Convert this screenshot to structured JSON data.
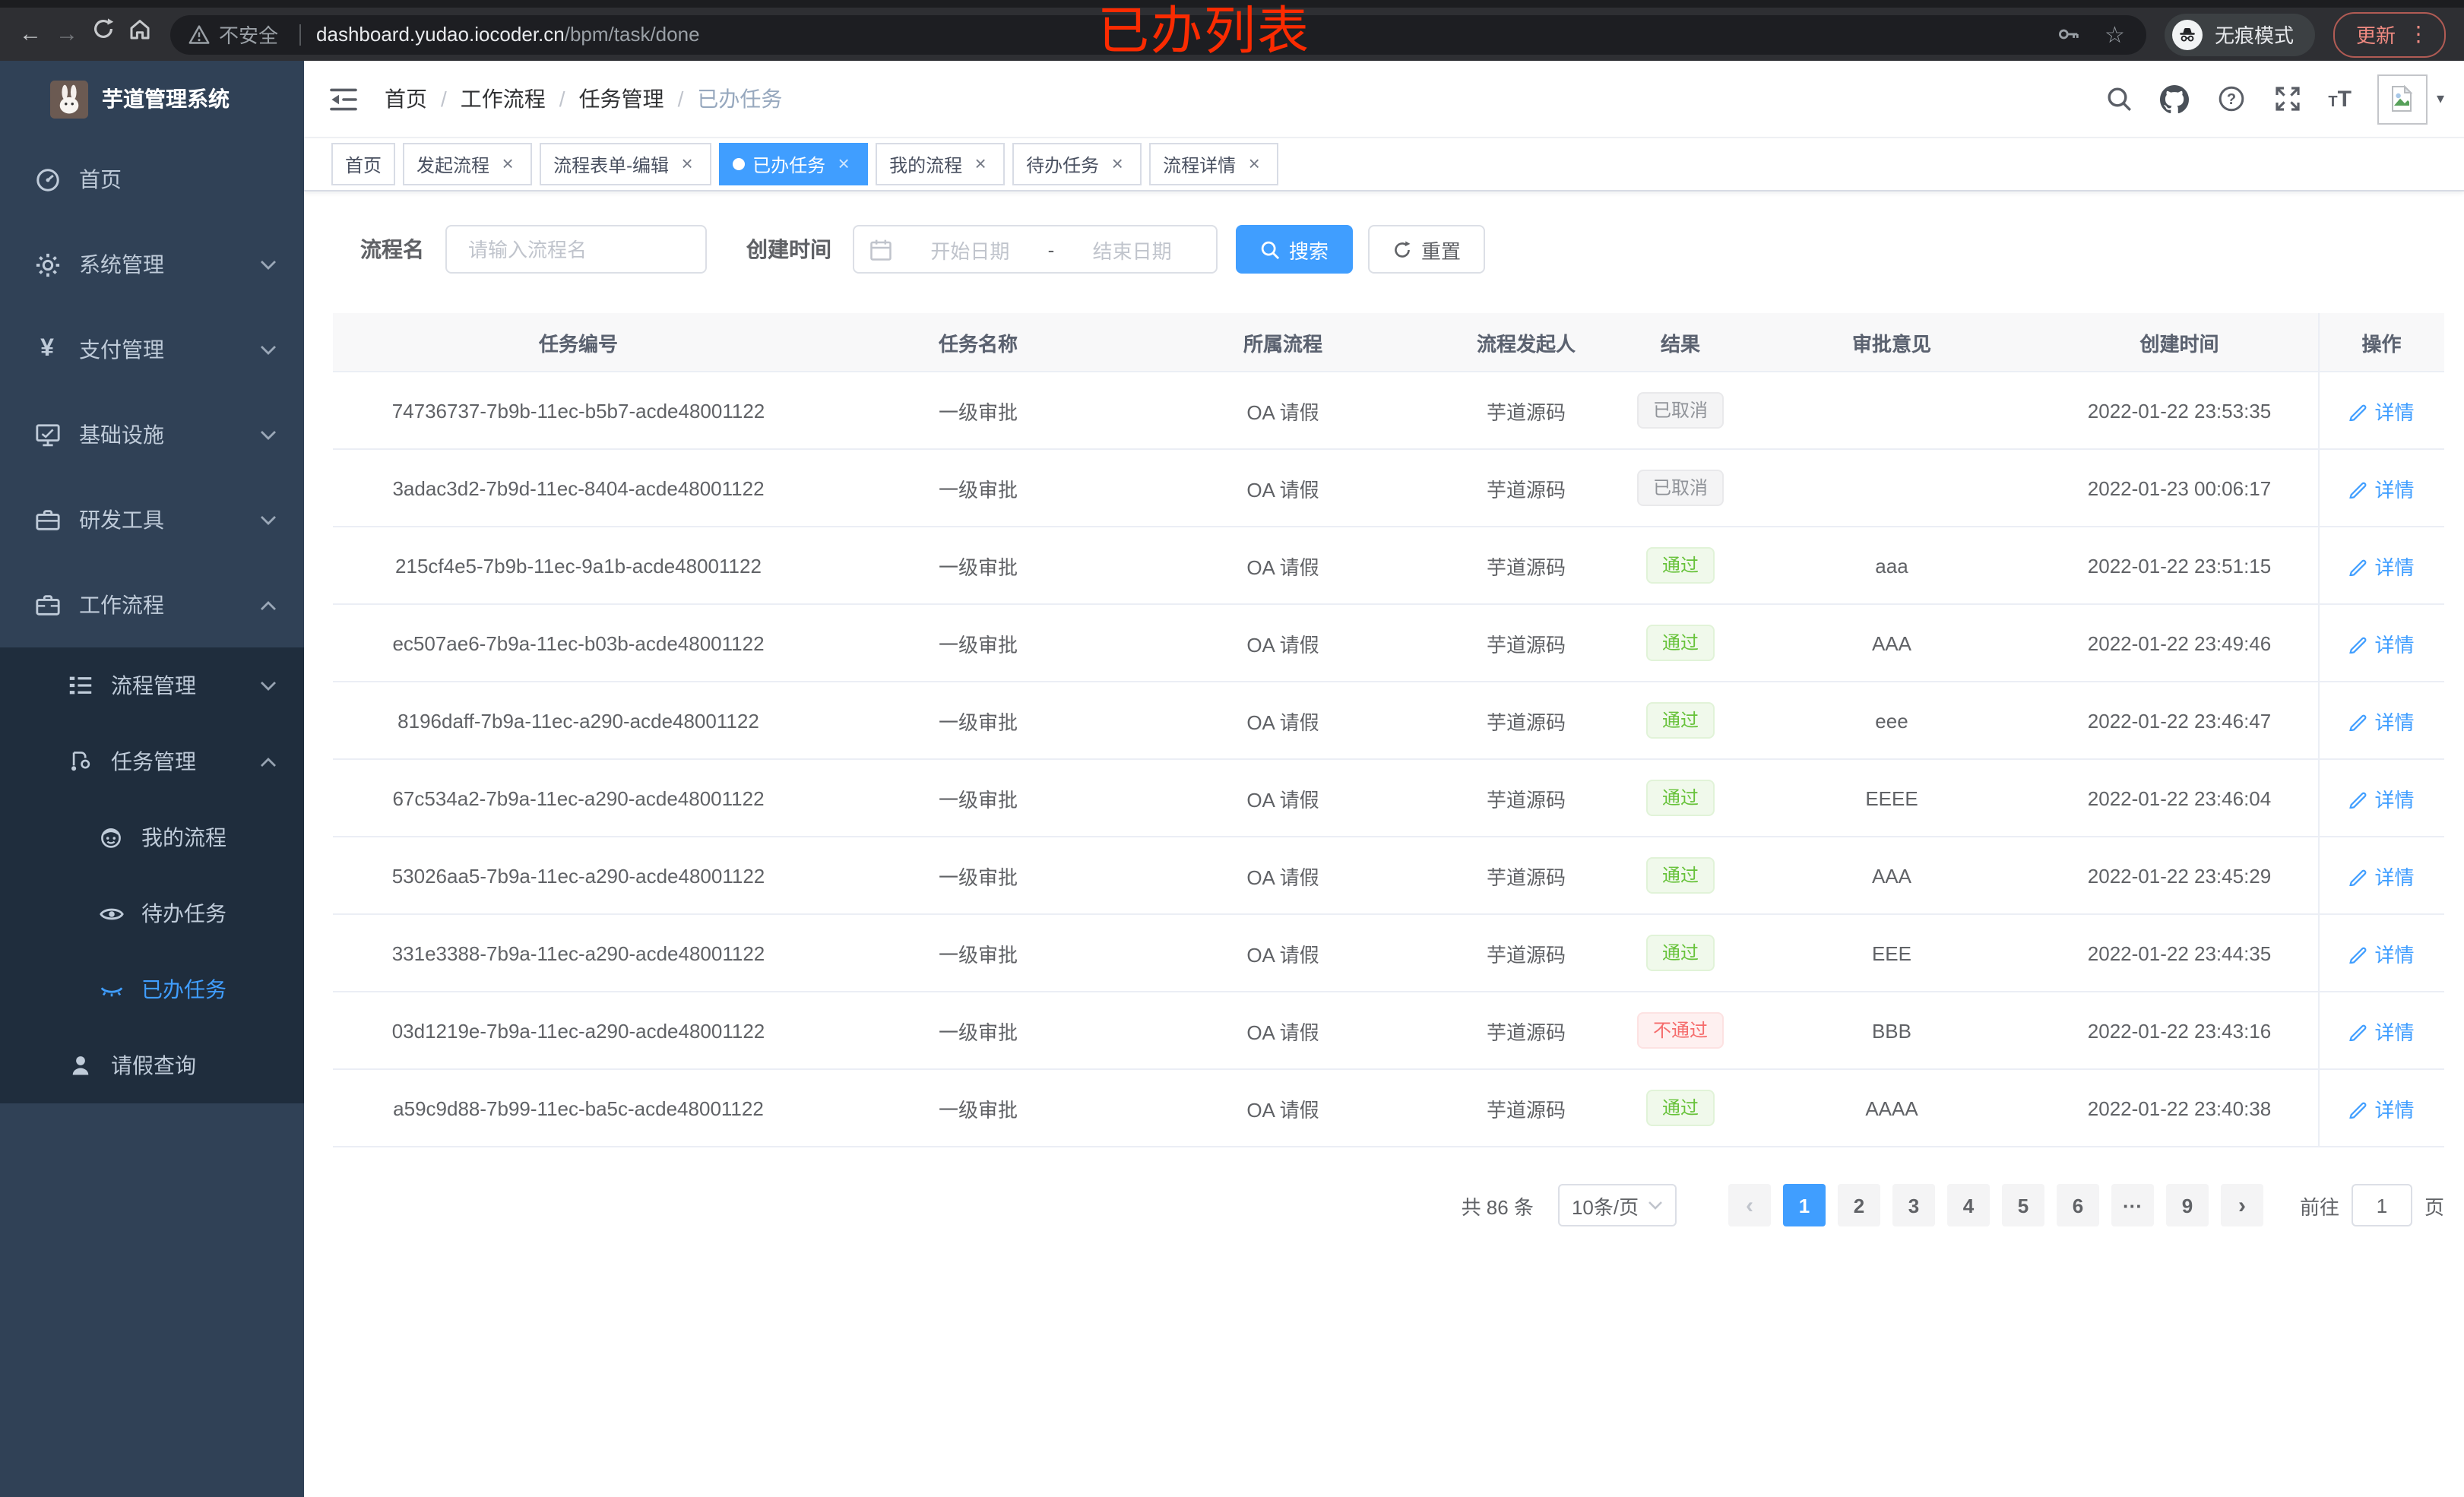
{
  "browser": {
    "security_label": "不安全",
    "url_domain": "dashboard.yudao.iocoder.cn",
    "url_path": "/bpm/task/done",
    "incognito_label": "无痕模式",
    "update_label": "更新"
  },
  "annotation": {
    "text": "已办列表",
    "color": "#fb2b01"
  },
  "sidebar": {
    "app_title": "芋道管理系统",
    "menu": [
      {
        "label": "首页"
      },
      {
        "label": "系统管理"
      },
      {
        "label": "支付管理"
      },
      {
        "label": "基础设施"
      },
      {
        "label": "研发工具"
      },
      {
        "label": "工作流程"
      }
    ],
    "submenu": [
      {
        "label": "流程管理"
      },
      {
        "label": "任务管理"
      },
      {
        "label": "我的流程"
      },
      {
        "label": "待办任务"
      },
      {
        "label": "已办任务"
      },
      {
        "label": "请假查询"
      }
    ]
  },
  "navbar": {
    "breadcrumb": [
      "首页",
      "工作流程",
      "任务管理",
      "已办任务"
    ]
  },
  "tabs": [
    {
      "label": "首页"
    },
    {
      "label": "发起流程",
      "closable": true
    },
    {
      "label": "流程表单-编辑",
      "closable": true
    },
    {
      "label": "已办任务",
      "closable": true,
      "state": "active",
      "dot": true
    },
    {
      "label": "我的流程",
      "closable": true
    },
    {
      "label": "待办任务",
      "closable": true
    },
    {
      "label": "流程详情",
      "closable": true
    }
  ],
  "filters": {
    "name_label": "流程名",
    "name_placeholder": "请输入流程名",
    "date_label": "创建时间",
    "date_start_placeholder": "开始日期",
    "date_separator": "-",
    "date_end_placeholder": "结束日期",
    "search_label": "搜索",
    "reset_label": "重置"
  },
  "table": {
    "action_label": "详情",
    "columns": [
      {
        "label": "任务编号"
      },
      {
        "label": "任务名称"
      },
      {
        "label": "所属流程"
      },
      {
        "label": "流程发起人"
      },
      {
        "label": "结果"
      },
      {
        "label": "审批意见"
      },
      {
        "label": "创建时间"
      },
      {
        "label": "操作",
        "cls": "col-action"
      }
    ],
    "rows": [
      {
        "id": "74736737-7b9b-11ec-b5b7-acde48001122",
        "name": "一级审批",
        "process": "OA 请假",
        "initiator": "芋道源码",
        "result": "已取消",
        "result_type": "info",
        "comment": "",
        "time": "2022-01-22 23:53:35"
      },
      {
        "id": "3adac3d2-7b9d-11ec-8404-acde48001122",
        "name": "一级审批",
        "process": "OA 请假",
        "initiator": "芋道源码",
        "result": "已取消",
        "result_type": "info",
        "comment": "",
        "time": "2022-01-23 00:06:17"
      },
      {
        "id": "215cf4e5-7b9b-11ec-9a1b-acde48001122",
        "name": "一级审批",
        "process": "OA 请假",
        "initiator": "芋道源码",
        "result": "通过",
        "result_type": "success",
        "comment": "aaa",
        "time": "2022-01-22 23:51:15"
      },
      {
        "id": "ec507ae6-7b9a-11ec-b03b-acde48001122",
        "name": "一级审批",
        "process": "OA 请假",
        "initiator": "芋道源码",
        "result": "通过",
        "result_type": "success",
        "comment": "AAA",
        "time": "2022-01-22 23:49:46"
      },
      {
        "id": "8196daff-7b9a-11ec-a290-acde48001122",
        "name": "一级审批",
        "process": "OA 请假",
        "initiator": "芋道源码",
        "result": "通过",
        "result_type": "success",
        "comment": "eee",
        "time": "2022-01-22 23:46:47"
      },
      {
        "id": "67c534a2-7b9a-11ec-a290-acde48001122",
        "name": "一级审批",
        "process": "OA 请假",
        "initiator": "芋道源码",
        "result": "通过",
        "result_type": "success",
        "comment": "EEEE",
        "time": "2022-01-22 23:46:04"
      },
      {
        "id": "53026aa5-7b9a-11ec-a290-acde48001122",
        "name": "一级审批",
        "process": "OA 请假",
        "initiator": "芋道源码",
        "result": "通过",
        "result_type": "success",
        "comment": "AAA",
        "time": "2022-01-22 23:45:29"
      },
      {
        "id": "331e3388-7b9a-11ec-a290-acde48001122",
        "name": "一级审批",
        "process": "OA 请假",
        "initiator": "芋道源码",
        "result": "通过",
        "result_type": "success",
        "comment": "EEE",
        "time": "2022-01-22 23:44:35"
      },
      {
        "id": "03d1219e-7b9a-11ec-a290-acde48001122",
        "name": "一级审批",
        "process": "OA 请假",
        "initiator": "芋道源码",
        "result": "不通过",
        "result_type": "danger",
        "comment": "BBB",
        "time": "2022-01-22 23:43:16"
      },
      {
        "id": "a59c9d88-7b99-11ec-ba5c-acde48001122",
        "name": "一级审批",
        "process": "OA 请假",
        "initiator": "芋道源码",
        "result": "通过",
        "result_type": "success",
        "comment": "AAAA",
        "time": "2022-01-22 23:40:38"
      }
    ]
  },
  "pagination": {
    "total_label": "共 86 条",
    "page_size_label": "10条/页",
    "pages": [
      {
        "label": "1",
        "state": "active"
      },
      {
        "label": "2"
      },
      {
        "label": "3"
      },
      {
        "label": "4"
      },
      {
        "label": "5"
      },
      {
        "label": "6"
      },
      {
        "label": "···",
        "state": "more"
      },
      {
        "label": "9"
      }
    ],
    "jump_prefix": "前往",
    "jump_value": "1",
    "jump_suffix": "页"
  },
  "colors": {
    "accent": "#409eff",
    "success": "#67c23a",
    "danger": "#f56c6c",
    "info": "#909399",
    "sidebar_bg": "#304156",
    "submenu_bg": "#1f2d3d",
    "annotation_red": "#fb2b01"
  }
}
